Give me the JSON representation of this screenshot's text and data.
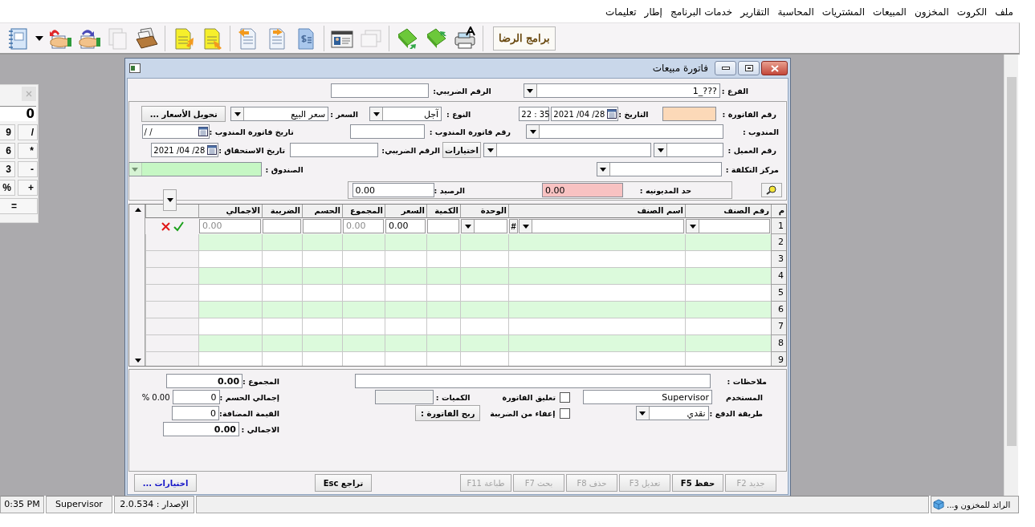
{
  "menu": [
    "ملف",
    "الكروت",
    "المخزون",
    "المبيعات",
    "المشتريات",
    "المحاسبة",
    "التقارير",
    "خدمات البرنامج",
    "إطار",
    "تعليمات"
  ],
  "toolbar": {
    "groups": [
      [
        {
          "kind": "notebook",
          "disabled": false
        },
        {
          "kind": "caret",
          "disabled": false
        },
        {
          "kind": "hand-out",
          "disabled": false
        },
        {
          "kind": "hand-in",
          "disabled": false
        },
        {
          "kind": "copy",
          "disabled": true
        },
        {
          "kind": "card-box",
          "disabled": false
        }
      ],
      [
        {
          "kind": "doc-in",
          "disabled": false
        },
        {
          "kind": "doc-out",
          "disabled": false
        }
      ],
      [
        {
          "kind": "page-in",
          "disabled": false
        },
        {
          "kind": "page-out",
          "disabled": false
        },
        {
          "kind": "dollar-doc",
          "disabled": false
        }
      ],
      [
        {
          "kind": "id-card",
          "disabled": false
        },
        {
          "kind": "windows",
          "disabled": true
        }
      ],
      [
        {
          "kind": "book-in",
          "disabled": false
        },
        {
          "kind": "book-out",
          "disabled": false
        },
        {
          "kind": "printer",
          "disabled": false
        }
      ]
    ],
    "logo": "برامج الرضا"
  },
  "calculator": {
    "display": "0",
    "keys": [
      "/",
      "9",
      "*",
      "6",
      "-",
      "3",
      "+",
      "%",
      "="
    ]
  },
  "invoice": {
    "title": "فاتورة مبيعات",
    "top": {
      "branch_label": "الفرع :",
      "branch": "???_1",
      "tax_label": "الرقم الضريبي:"
    },
    "header": {
      "invoice_no_label": "رقم الفاتورة :",
      "date_label": "التاريخ :",
      "date": "2021 /04 /28",
      "time": "22 : 35",
      "type_label": "النوع :",
      "type": "آجل",
      "price_label": "السعر :",
      "price": "سعر البيع",
      "convert_button": "تحويل الأسعار ...",
      "rep_label": "المندوب :",
      "rep_invoice_label": "رقم فاتورة المندوب :",
      "rep_date_label": "تاريخ فاتورة المندوب :",
      "rep_date": "/   /",
      "customer_label": "رقم العميل :",
      "options_button": "اختيارات",
      "customer_tax_label": "الرقم الضريبي:",
      "due_label": "تاريخ الاستحقاق :",
      "due_date": "2021 /04 /28",
      "cost_center_label": "مركز التكلفة :",
      "cashbox_label": "الصندوق :",
      "cashbox_disabled": true,
      "credit_limit_label": "حد المديونيه :",
      "credit_limit": "0.00",
      "balance_label": "الرصيد :",
      "balance": "0.00"
    },
    "grid": {
      "columns": [
        "م",
        "رقم الصنف",
        "اسم الصنف",
        "الوحدة",
        "الكمية",
        "السعر",
        "المجموع",
        "الحسم",
        "الضريبة",
        "الاجمالي"
      ],
      "edit_row": {
        "number": "1",
        "cells": [
          {
            "kind": "combo"
          },
          {
            "kind": "combo-hash",
            "hash": "#"
          },
          {
            "kind": "combo"
          },
          {
            "kind": "input"
          },
          {
            "kind": "input",
            "value": "0.00"
          },
          {
            "kind": "readonly",
            "value": "0.00"
          },
          {
            "kind": "input"
          },
          {
            "kind": "input"
          },
          {
            "kind": "readonly",
            "value": "0.00"
          }
        ]
      },
      "rows": [
        {
          "number": "2"
        },
        {
          "number": "3"
        },
        {
          "number": "4"
        },
        {
          "number": "5"
        },
        {
          "number": "6"
        },
        {
          "number": "7"
        },
        {
          "number": "8"
        },
        {
          "number": "9"
        }
      ]
    },
    "summary": {
      "notes_label": "ملاحظات :",
      "user_label": "المستخدم",
      "user": "Supervisor",
      "suspend": {
        "label": "تعليق الفاتورة",
        "checked": false
      },
      "quantities_label": "الكميات :",
      "payment_label": "طريقة الدفع :",
      "payment": "نقدي",
      "tax_exempt": {
        "label": "إعفاء من الضريبة",
        "checked": false
      },
      "profit_button": "ربح الفاتورة :",
      "sum_label": "المجموع :",
      "sum": "0.00",
      "discount_label": "إجمالي الحسم :",
      "discount": "0",
      "discount_pct": "% 0.00",
      "vat_label": "القيمة المضافة:",
      "vat": "0",
      "total_label": "الاجمالي :",
      "total": "0.00"
    },
    "footer": {
      "options": "اختيارات ...",
      "undo": "تراجع Esc",
      "actions": [
        {
          "label": "جديد F2",
          "disabled": true
        },
        {
          "label": "حفظ F5",
          "disabled": false
        },
        {
          "label": "تعديل F3",
          "disabled": true
        },
        {
          "label": "حذف F8",
          "disabled": true
        },
        {
          "label": "بحث F7",
          "disabled": true
        },
        {
          "label": "طباعة F11",
          "disabled": true
        }
      ]
    }
  },
  "status_bar": {
    "panels": [
      "الإصدار : 2.0.534",
      "Supervisor",
      "0:35 PM"
    ],
    "minimized_window": "الرائد للمخزون و..."
  }
}
